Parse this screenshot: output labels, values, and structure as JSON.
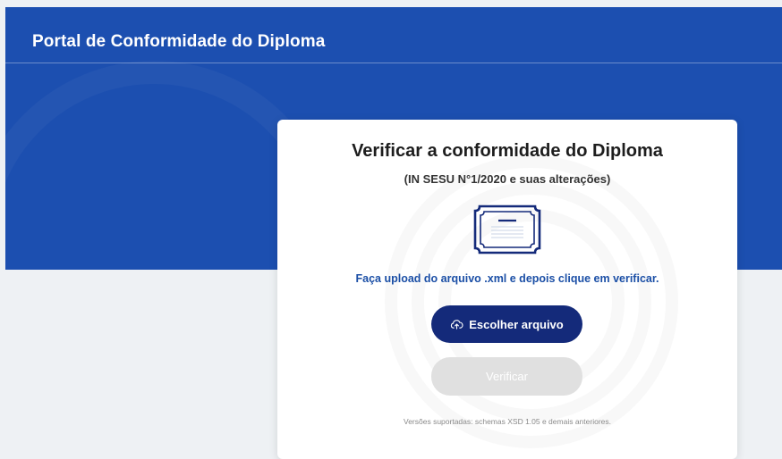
{
  "header": {
    "title": "Portal de Conformidade do Diploma"
  },
  "card": {
    "title": "Verificar a conformidade do Diploma",
    "subtitle": "(IN SESU N°1/2020 e suas alterações)",
    "icon": "diploma-certificate-icon",
    "instruction": "Faça upload do arquivo .xml e depois clique em verificar.",
    "choose_button": {
      "label": "Escolher arquivo",
      "icon": "cloud-upload-icon"
    },
    "verify_button": {
      "label": "Verificar",
      "state": "disabled"
    },
    "footer_note": "Versões suportadas: schemas XSD 1.05 e demais anteriores."
  },
  "colors": {
    "header_blue": "#1c4fb0",
    "primary_button": "#142a7a",
    "link_text": "#1b4fa6",
    "disabled_button": "#e0e0e0",
    "page_background": "#eef1f4"
  }
}
